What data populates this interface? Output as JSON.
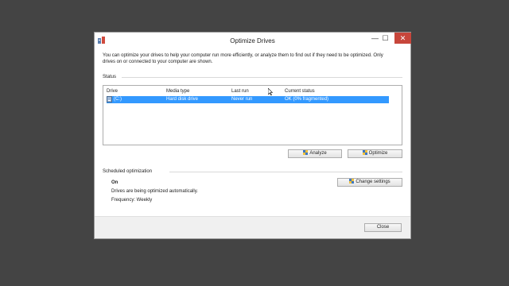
{
  "window": {
    "title": "Optimize Drives",
    "controls": {
      "minimize": "—",
      "maximize": "☐",
      "close": "✕"
    }
  },
  "intro_text": "You can optimize your drives to help your computer run more efficiently, or analyze them to find out if they need to be optimized. Only drives on or connected to your computer are shown.",
  "status": {
    "label": "Status",
    "columns": [
      "Drive",
      "Media type",
      "Last run",
      "Current status"
    ],
    "rows": [
      {
        "drive": "(C:)",
        "media_type": "Hard disk drive",
        "last_run": "Never run",
        "current_status": "OK (0% fragmented)",
        "selected": true
      }
    ]
  },
  "buttons": {
    "analyze": "Analyze",
    "optimize": "Optimize",
    "change_settings": "Change settings",
    "close": "Close"
  },
  "scheduled": {
    "label": "Scheduled optimization",
    "state": "On",
    "description": "Drives are being optimized automatically.",
    "frequency": "Frequency: Weekly"
  },
  "colors": {
    "selection": "#3399ff",
    "close_button": "#c7463b",
    "desktop": "#444444"
  },
  "icons": [
    "optimize-drives-app-icon",
    "hard-drive-icon",
    "uac-shield-icon",
    "mouse-cursor-icon"
  ]
}
